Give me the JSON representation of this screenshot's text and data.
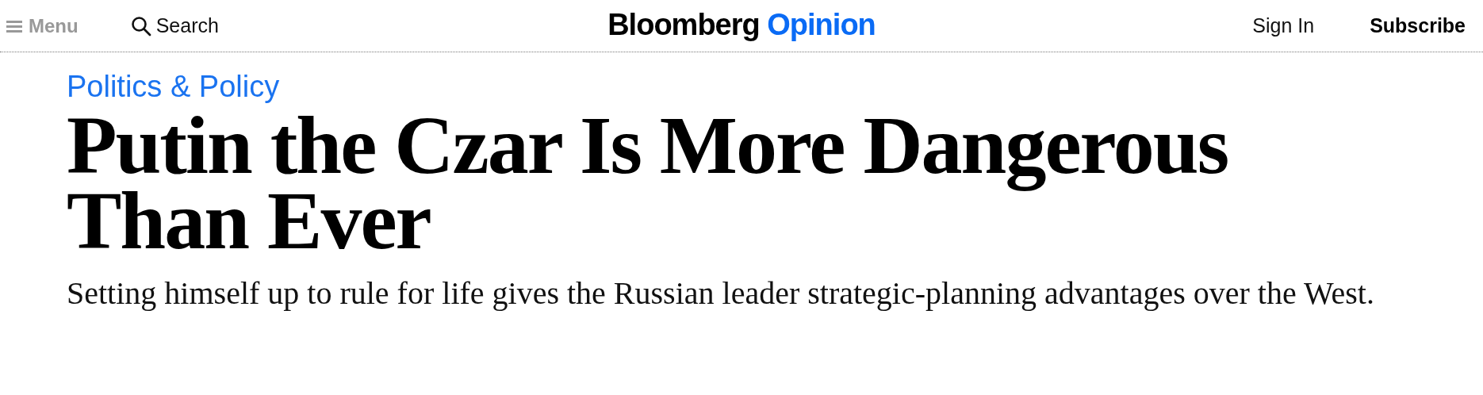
{
  "header": {
    "menu": "Menu",
    "search": "Search",
    "logo": {
      "brand": "Bloomberg",
      "section": "Opinion"
    },
    "sign_in": "Sign In",
    "subscribe": "Subscribe"
  },
  "article": {
    "category": "Politics & Policy",
    "headline": "Putin the Czar Is More Dangerous Than Ever",
    "dek": "Setting himself up to rule for life gives the Russian leader strategic-planning advantages over the West."
  }
}
